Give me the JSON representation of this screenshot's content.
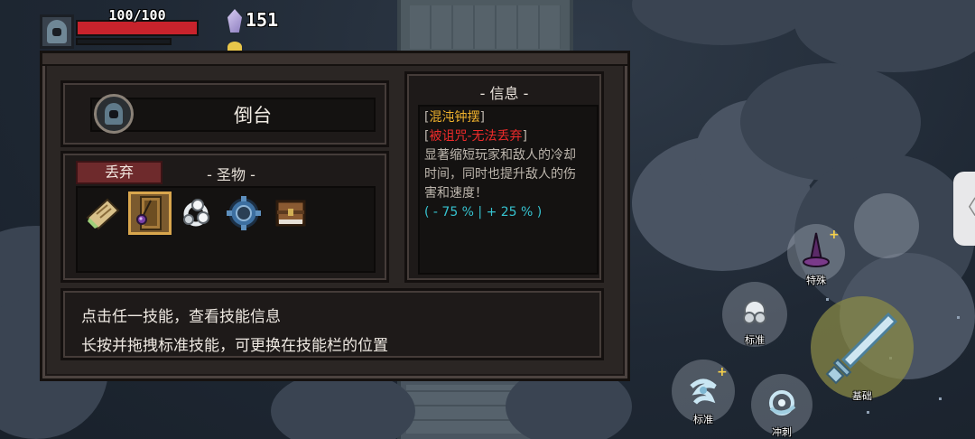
{
  "hud": {
    "hp_text": "100/100",
    "hp_fraction": 1.0,
    "gem_count": "151",
    "hp_color": "#c8232c"
  },
  "panel": {
    "character_name": "倒台",
    "discard_label": "丢弃",
    "relic_section_label": "- 圣物 -",
    "relics": [
      {
        "icon": "scroll-relic-icon",
        "selected": false
      },
      {
        "icon": "chaos-pendulum-icon",
        "selected": true
      },
      {
        "icon": "spirit-relic-icon",
        "selected": false
      },
      {
        "icon": "gear-ring-relic-icon",
        "selected": false
      },
      {
        "icon": "chest-relic-icon",
        "selected": false
      }
    ],
    "info_title": "- 信息 -",
    "info": {
      "bracket_open": "[",
      "bracket_close": "]",
      "item_name": "混沌钟摆",
      "curse_label": "被诅咒-无法丢弃",
      "desc_lines": [
        "显著缩短玩家和敌人的冷却",
        "时间，同时也提升敌人的伤",
        "害和速度！"
      ],
      "stats": "( - 75 % | + 25 % )"
    },
    "tips": [
      "点击任一技能，查看技能信息",
      "长按并拖拽标准技能，可更换在技能栏的位置"
    ]
  },
  "controls": {
    "side_handle": "〈",
    "skill_special_label": "特殊",
    "skill_standard_top_label": "标准",
    "skill_basic_label": "基础",
    "skill_standard_bottom_label": "标准",
    "skill_dash_label": "冲刺",
    "plus_mark": "+"
  },
  "colors": {
    "item_name": "#f0b22d",
    "curse": "#ee2b2b",
    "stats": "#36c2cf",
    "discard_tab": "#6e2a2c"
  }
}
